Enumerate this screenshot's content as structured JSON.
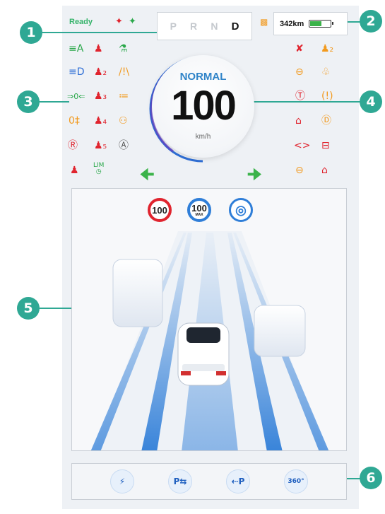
{
  "status": {
    "ready_label": "Ready"
  },
  "gears": [
    {
      "label": "P",
      "active": false
    },
    {
      "label": "R",
      "active": false
    },
    {
      "label": "N",
      "active": false
    },
    {
      "label": "D",
      "active": true
    }
  ],
  "range": {
    "value": "342km",
    "battery_level": 0.55
  },
  "speedometer": {
    "mode": "NORMAL",
    "speed": "100",
    "unit": "km/h"
  },
  "adas_signs": {
    "speed_limit": "100",
    "cruise_max": "100",
    "cruise_max_label": "MAX"
  },
  "callouts": [
    "1",
    "2",
    "3",
    "4",
    "5",
    "6"
  ],
  "controls": [
    {
      "name": "power-icon",
      "glyph": "⚡"
    },
    {
      "name": "park-assist-icon",
      "glyph": "P⇆"
    },
    {
      "name": "auto-park-icon",
      "glyph": "⇠P"
    },
    {
      "name": "surround-view-icon",
      "glyph": "360°"
    }
  ],
  "colors": {
    "accent": "#2fa894",
    "ok": "#2aa84a",
    "warn": "#f29a1f",
    "alert": "#e0242e",
    "info": "#2f7ed8"
  }
}
